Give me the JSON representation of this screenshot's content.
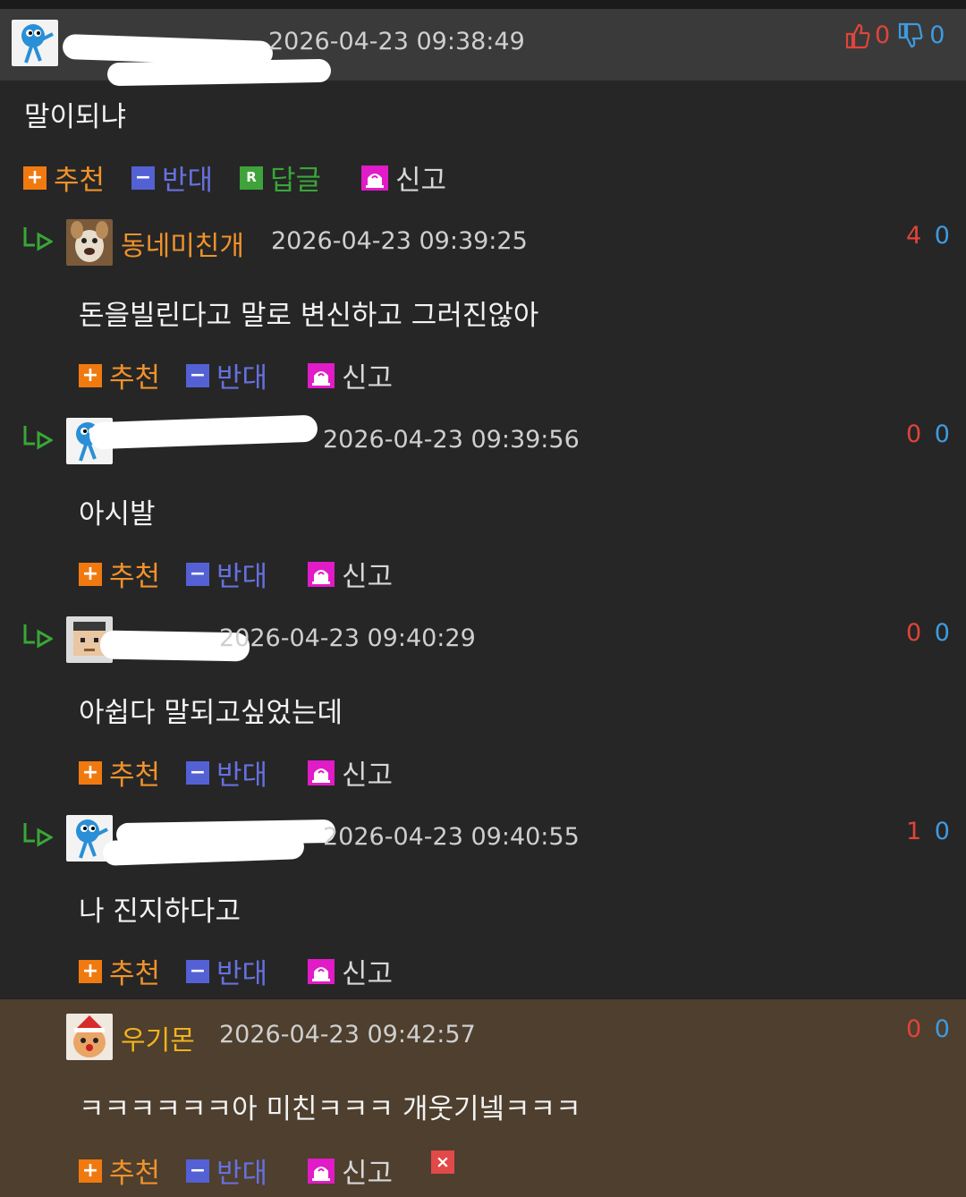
{
  "comments": [
    {
      "nickname": "",
      "date": "2026-04-23 09:38:49",
      "up": "0",
      "down": "0",
      "text": "말이되냐",
      "is_reply": false,
      "actions": {
        "recommend": "추천",
        "oppose": "반대",
        "reply": "답글",
        "report": "신고"
      }
    },
    {
      "nickname": "동네미친개",
      "date": "2026-04-23 09:39:25",
      "up": "4",
      "down": "0",
      "text": "돈을빌린다고 말로 변신하고 그러진않아",
      "is_reply": true,
      "actions": {
        "recommend": "추천",
        "oppose": "반대",
        "report": "신고"
      }
    },
    {
      "nickname": "",
      "date": "2026-04-23 09:39:56",
      "up": "0",
      "down": "0",
      "text": "아시발",
      "is_reply": true,
      "actions": {
        "recommend": "추천",
        "oppose": "반대",
        "report": "신고"
      }
    },
    {
      "nickname": "",
      "date": "2026-04-23 09:40:29",
      "up": "0",
      "down": "0",
      "text": "아쉽다 말되고싶었는데",
      "is_reply": true,
      "actions": {
        "recommend": "추천",
        "oppose": "반대",
        "report": "신고"
      }
    },
    {
      "nickname": "",
      "date": "2026-04-23 09:40:55",
      "up": "1",
      "down": "0",
      "text": "나 진지하다고",
      "is_reply": true,
      "actions": {
        "recommend": "추천",
        "oppose": "반대",
        "report": "신고"
      }
    },
    {
      "nickname": "우기몬",
      "date": "2026-04-23 09:42:57",
      "up": "0",
      "down": "0",
      "text": "ㅋㅋㅋㅋㅋㅋ아 미친ㅋㅋㅋ 개웃기넼ㅋㅋㅋ",
      "is_reply": false,
      "actions": {
        "recommend": "추천",
        "oppose": "반대",
        "report": "신고",
        "delete": "×"
      }
    }
  ],
  "colors": {
    "background": "#262626",
    "header": "#3a3a3a",
    "own_comment_bg": "#4e3f2e",
    "nickname": "#f0922b",
    "upvote": "#e0443a",
    "downvote": "#3e9be0"
  },
  "icons": [
    "thumbs-up-icon",
    "thumbs-down-icon",
    "reply-arrow-icon",
    "plus-icon",
    "minus-icon",
    "reply-r-icon",
    "siren-icon",
    "delete-x-icon"
  ]
}
